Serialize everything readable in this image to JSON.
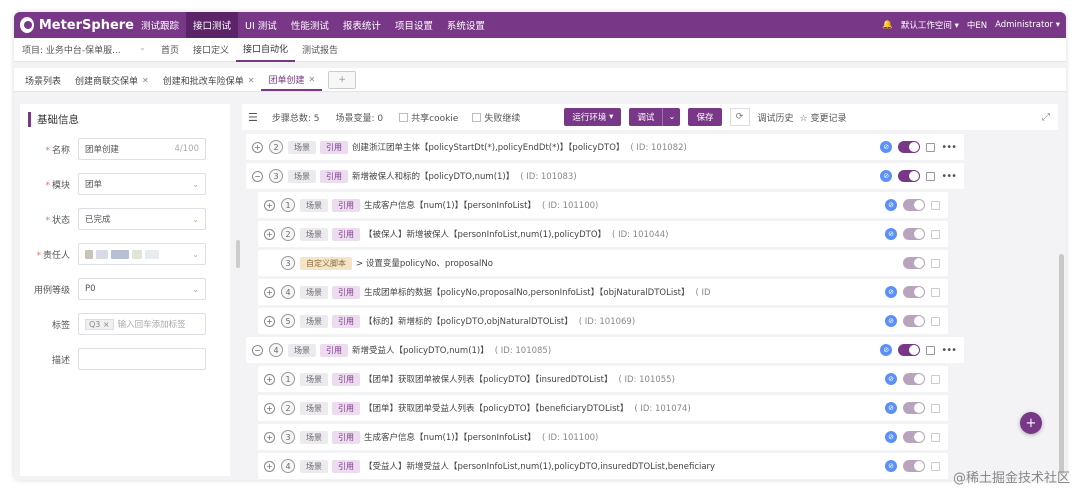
{
  "app": {
    "name": "MeterSphere"
  },
  "topnav": {
    "items": [
      "测试跟踪",
      "接口测试",
      "UI 测试",
      "性能测试",
      "报表统计",
      "项目设置",
      "系统设置"
    ],
    "active_index": 1
  },
  "topright": {
    "workspace": "默认工作空间",
    "lang_icon": "中EN",
    "user": "Administrator"
  },
  "project_selector": {
    "label": "项目: 业务中台-保单服..."
  },
  "subnav": {
    "items": [
      "首页",
      "接口定义",
      "接口自动化",
      "测试报告"
    ],
    "active_index": 2
  },
  "tabs": {
    "items": [
      {
        "label": "场景列表",
        "closable": false
      },
      {
        "label": "创建商联交保单",
        "closable": true
      },
      {
        "label": "创建和批改车险保单",
        "closable": true
      },
      {
        "label": "团单创建",
        "closable": true,
        "active": true
      }
    ],
    "add_label": "+"
  },
  "form": {
    "section_title": "基础信息",
    "name": {
      "label": "名称",
      "value": "团单创建",
      "counter": "4/100"
    },
    "module": {
      "label": "模块",
      "value": "团单"
    },
    "status": {
      "label": "状态",
      "value": "已完成"
    },
    "owner": {
      "label": "责任人"
    },
    "level": {
      "label": "用例等级",
      "value": "P0"
    },
    "tags": {
      "label": "标签",
      "tag": "Q3",
      "placeholder": "输入回车添加标签"
    },
    "desc": {
      "label": "描述"
    }
  },
  "toolbar": {
    "step_count": "步骤总数: 5",
    "variables": "场景变量: 0",
    "share_cookie": "共享cookie",
    "fail_continue": "失败继续",
    "env_button": "运行环境",
    "debug_button": "调试",
    "save_button": "保存",
    "history_link": "调试历史",
    "changelog_link": "变更记录"
  },
  "steps": [
    {
      "indent": 0,
      "toggle": "+",
      "num": "2",
      "badges": [
        "场景",
        "引用"
      ],
      "text": "创建浙江团单主体【policyStartDt(*),policyEndDt(*)】【policyDTO】",
      "id": "( ID: 101082)",
      "status_icon": true,
      "enabled": true,
      "more": true
    },
    {
      "indent": 0,
      "toggle": "−",
      "num": "3",
      "badges": [
        "场景",
        "引用"
      ],
      "text": "新增被保人和标的【policyDTO,num(1)】",
      "id": "( ID: 101083)",
      "status_icon": true,
      "enabled": true,
      "more": true
    },
    {
      "indent": 1,
      "toggle": "+",
      "num": "1",
      "badges": [
        "场景",
        "引用"
      ],
      "text": "生成客户信息【num(1)】【personInfoList】",
      "id": "( ID: 101100)",
      "status_icon": true,
      "enabled": false,
      "more": false
    },
    {
      "indent": 1,
      "toggle": "+",
      "num": "2",
      "badges": [
        "场景",
        "引用"
      ],
      "text": "【被保人】新增被保人【personInfoList,num(1),policyDTO】",
      "id": "( ID: 101044)",
      "status_icon": true,
      "enabled": false,
      "more": false
    },
    {
      "indent": 1,
      "toggle": "",
      "num": "3",
      "badges": [
        "自定义脚本"
      ],
      "text": "> 设置变量policyNo、proposalNo",
      "id": "",
      "status_icon": false,
      "enabled": false,
      "more": false
    },
    {
      "indent": 1,
      "toggle": "+",
      "num": "4",
      "badges": [
        "场景",
        "引用"
      ],
      "text": "生成团单标的数据【policyNo,proposalNo,personInfoList】【objNaturalDTOList】",
      "id": "( ID",
      "status_icon": true,
      "enabled": false,
      "more": false
    },
    {
      "indent": 1,
      "toggle": "+",
      "num": "5",
      "badges": [
        "场景",
        "引用"
      ],
      "text": "【标的】新增标的【policyDTO,objNaturalDTOList】",
      "id": "( ID: 101069)",
      "status_icon": true,
      "enabled": false,
      "more": false
    },
    {
      "indent": 0,
      "toggle": "−",
      "num": "4",
      "badges": [
        "场景",
        "引用"
      ],
      "text": "新增受益人【policyDTO,num(1)】",
      "id": "( ID: 101085)",
      "status_icon": true,
      "enabled": true,
      "more": true
    },
    {
      "indent": 1,
      "toggle": "+",
      "num": "1",
      "badges": [
        "场景",
        "引用"
      ],
      "text": "【团单】获取团单被保人列表【policyDTO】【insuredDTOList】",
      "id": "( ID: 101055)",
      "status_icon": true,
      "enabled": false,
      "more": false
    },
    {
      "indent": 1,
      "toggle": "+",
      "num": "2",
      "badges": [
        "场景",
        "引用"
      ],
      "text": "【团单】获取团单受益人列表【policyDTO】【beneficiaryDTOList】",
      "id": "( ID: 101074)",
      "status_icon": true,
      "enabled": false,
      "more": false
    },
    {
      "indent": 1,
      "toggle": "+",
      "num": "3",
      "badges": [
        "场景",
        "引用"
      ],
      "text": "生成客户信息【num(1)】【personInfoList】",
      "id": "( ID: 101100)",
      "status_icon": true,
      "enabled": false,
      "more": false
    },
    {
      "indent": 1,
      "toggle": "+",
      "num": "4",
      "badges": [
        "场景",
        "引用"
      ],
      "text": "【受益人】新增受益人【personInfoList,num(1),policyDTO,insuredDTOList,beneficiary",
      "id": "",
      "status_icon": true,
      "enabled": false,
      "more": false
    }
  ],
  "fab_label": "+",
  "watermark": "@稀土掘金技术社区",
  "colors": {
    "brand": "#783887",
    "status_blue": "#5b8ff9"
  }
}
